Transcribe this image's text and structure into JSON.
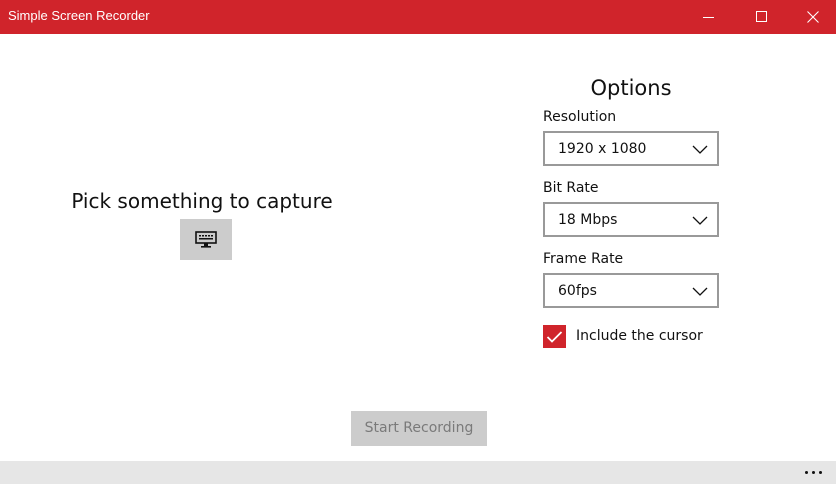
{
  "window": {
    "title": "Simple Screen Recorder",
    "accent_color": "#d0242b",
    "controls": [
      "minimize-icon",
      "maximize-icon",
      "close-icon"
    ]
  },
  "capture": {
    "label": "Pick something to capture",
    "button_icon": "monitor-icon"
  },
  "options": {
    "title": "Options",
    "resolution": {
      "label": "Resolution",
      "value": "1920 x 1080"
    },
    "bit_rate": {
      "label": "Bit Rate",
      "value": "18 Mbps"
    },
    "frame_rate": {
      "label": "Frame Rate",
      "value": "60fps"
    },
    "include_cursor": {
      "label": "Include the cursor",
      "checked": true
    }
  },
  "actions": {
    "start_label": "Start Recording",
    "start_enabled": false
  },
  "appbar": {
    "more_icon": "more-icon"
  }
}
